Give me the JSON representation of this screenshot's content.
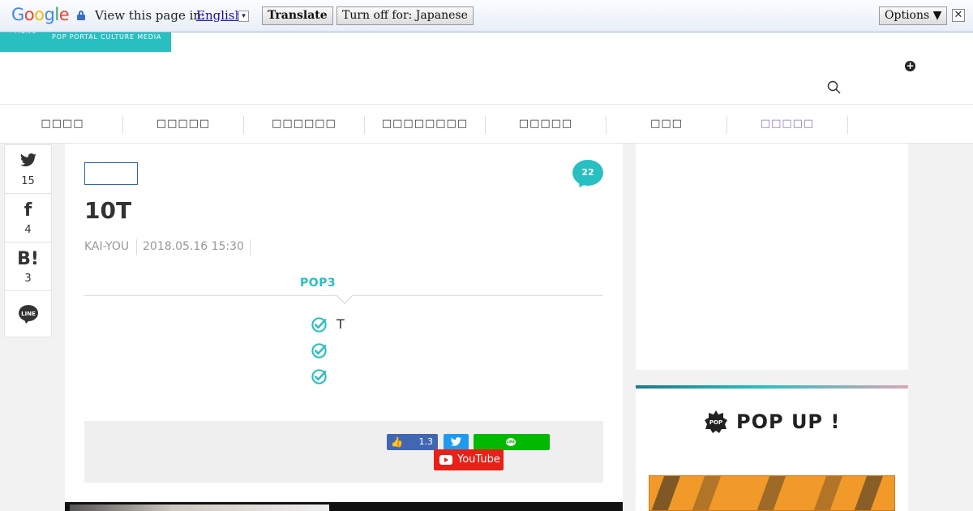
{
  "translate_bar": {
    "logo": "Google",
    "prompt": "View this page in:",
    "language": "English",
    "dropdown_glyph": "▾",
    "translate_label": "Translate",
    "turn_off_label": "Turn off for: Japanese",
    "options_label": "Options ▼",
    "close_glyph": "✕"
  },
  "header": {
    "menu_label": "MENU",
    "tagline": "POP PORTAL CULTURE MEDIA",
    "plus_glyph": "+",
    "icons": [
      "plus-icon",
      "search-icon"
    ]
  },
  "nav": {
    "items": [
      "□□□□",
      "□□□□□",
      "□□□□□□",
      "□□□□□□□□",
      "□□□□□",
      "□□□",
      "□□□□□"
    ],
    "active_color": "#8a77b8"
  },
  "share": {
    "twitter_count": "15",
    "facebook_glyph": "f",
    "facebook_count": "4",
    "hatena_glyph": "B!",
    "hatena_count": "3",
    "line_label": "LINE"
  },
  "article": {
    "comment_count": "22",
    "title": "10T",
    "author": "KAI-YOU",
    "date": "2018.05.16 15:30",
    "pop3_heading": "POP3",
    "points": [
      "T",
      "",
      ""
    ],
    "accent_color": "#28bfc0"
  },
  "follow": {
    "fb_like_count": "1.3",
    "fb_thumb": "👍",
    "line_badge": "LINE",
    "youtube_label": "YouTube"
  },
  "sidebar": {
    "popup_badge": "POP",
    "popup_title": "POP UP !"
  }
}
